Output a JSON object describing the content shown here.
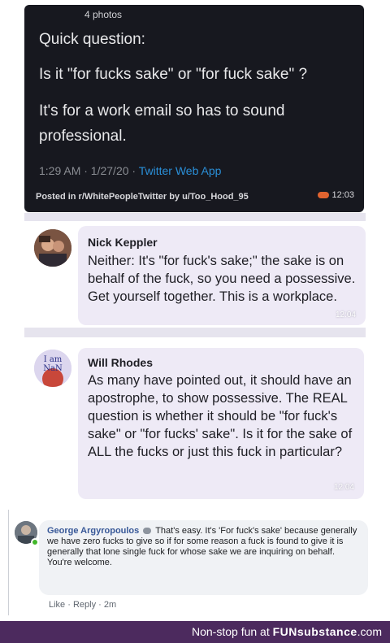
{
  "tweet": {
    "photos": "4 photos",
    "line1": "Quick question:",
    "line2": "Is it \"for fucks sake\" or \"for fuck sake\" ?",
    "line3": "It's for a work email so has to sound professional.",
    "time": "1:29 AM · 1/27/20 · ",
    "app": "Twitter Web App",
    "posted": "Posted in r/WhitePeopleTwitter by u/Too_Hood_95",
    "clock": "12:03"
  },
  "messages": [
    {
      "name": "Nick Keppler",
      "text": "Neither: It's \"for fuck's sake;\" the sake is on behalf of the fuck, so you need a possessive. Get yourself together. This is a workplace.",
      "stamp": "12:04"
    },
    {
      "name": "Will Rhodes",
      "avatar_text": "I am NaN",
      "text": "As many have pointed out, it should have an apostrophe, to show possessive. The REAL question is whether it should be \"for fuck's sake\" or \"for fucks' sake\". Is it for the sake of ALL the fucks or just this fuck in particular?",
      "stamp": "12:04"
    }
  ],
  "comment": {
    "name": "George Argyropoulos",
    "icon": "messenger-icon",
    "text": "That's easy. It's 'For fuck's sake' because generally we have zero fucks to give so if for some reason a fuck is found to give it is generally that lone single fuck for whose sake we are inquiring on behalf.",
    "closing": "You're welcome.",
    "like": "Like",
    "reply": "Reply",
    "age": "2m"
  },
  "footer": {
    "prefix": "Non-stop fun at ",
    "brand": "FUNsubstance",
    "suffix": ".com"
  }
}
